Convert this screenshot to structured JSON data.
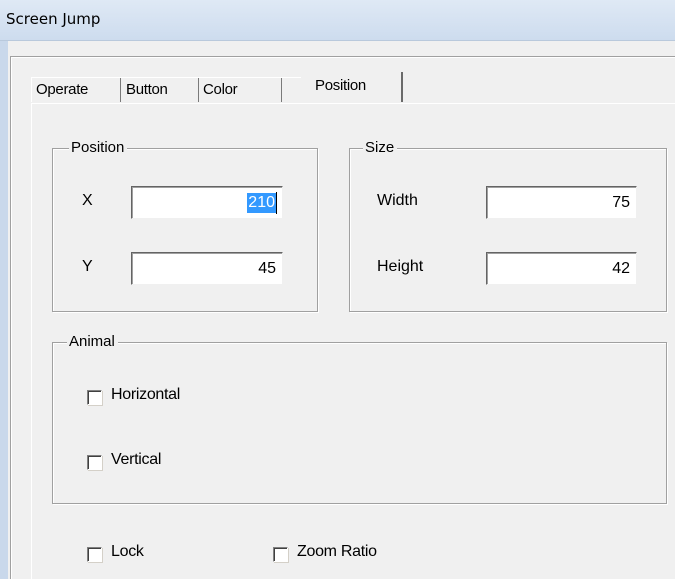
{
  "window": {
    "title": "Screen Jump"
  },
  "tabs": [
    {
      "label": "Operate",
      "active": false
    },
    {
      "label": "Button",
      "active": false
    },
    {
      "label": "Color",
      "active": false
    },
    {
      "label": "Position",
      "active": true
    }
  ],
  "position_group": {
    "title": "Position",
    "x_label": "X",
    "x_value": "210",
    "y_label": "Y",
    "y_value": "45"
  },
  "size_group": {
    "title": "Size",
    "width_label": "Width",
    "width_value": "75",
    "height_label": "Height",
    "height_value": "42"
  },
  "animal_group": {
    "title": "Animal",
    "horizontal_label": "Horizontal",
    "horizontal_checked": false,
    "vertical_label": "Vertical",
    "vertical_checked": false
  },
  "options": {
    "lock_label": "Lock",
    "lock_checked": false,
    "zoom_ratio_label": "Zoom Ratio",
    "zoom_ratio_checked": false
  },
  "colors": {
    "selection": "#3399ff",
    "titlebar": "#d6e3f2",
    "dialog_bg": "#f0f0f0"
  }
}
